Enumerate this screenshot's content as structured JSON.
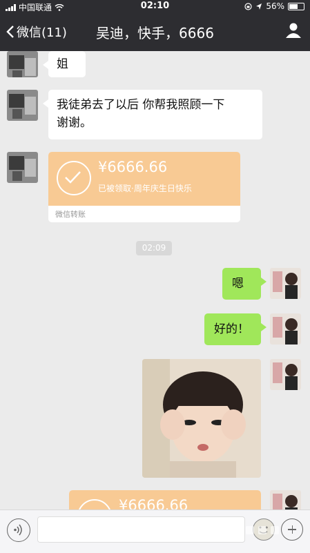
{
  "status_bar": {
    "carrier": "中国联通",
    "time": "02:10",
    "battery": "56%",
    "battery_level": 0.56
  },
  "header": {
    "back_label": "微信(11)",
    "title": "吴迪，快手，6666"
  },
  "messages": [
    {
      "text": "姐"
    },
    {
      "text": "我徒弟去了以后 你帮我照顾一下\n谢谢。"
    },
    {
      "amount": "¥6666.66",
      "note": "已被领取·周年庆生日快乐",
      "footer": "微信转账"
    },
    {
      "time": "02:09"
    },
    {
      "text": "嗯"
    },
    {
      "text": "好的！"
    },
    {
      "amount": "¥6666.66"
    }
  ],
  "colors": {
    "navbar": "#2d2d31",
    "outgoing_bubble": "#a0e75a",
    "transfer_card": "#f8ca94",
    "chat_bg": "#ebebeb"
  },
  "icons": {
    "back": "chevron-left-icon",
    "profile": "person-icon",
    "voice": "voice-icon",
    "emoji": "sticker-face-icon",
    "more": "plus-icon"
  }
}
